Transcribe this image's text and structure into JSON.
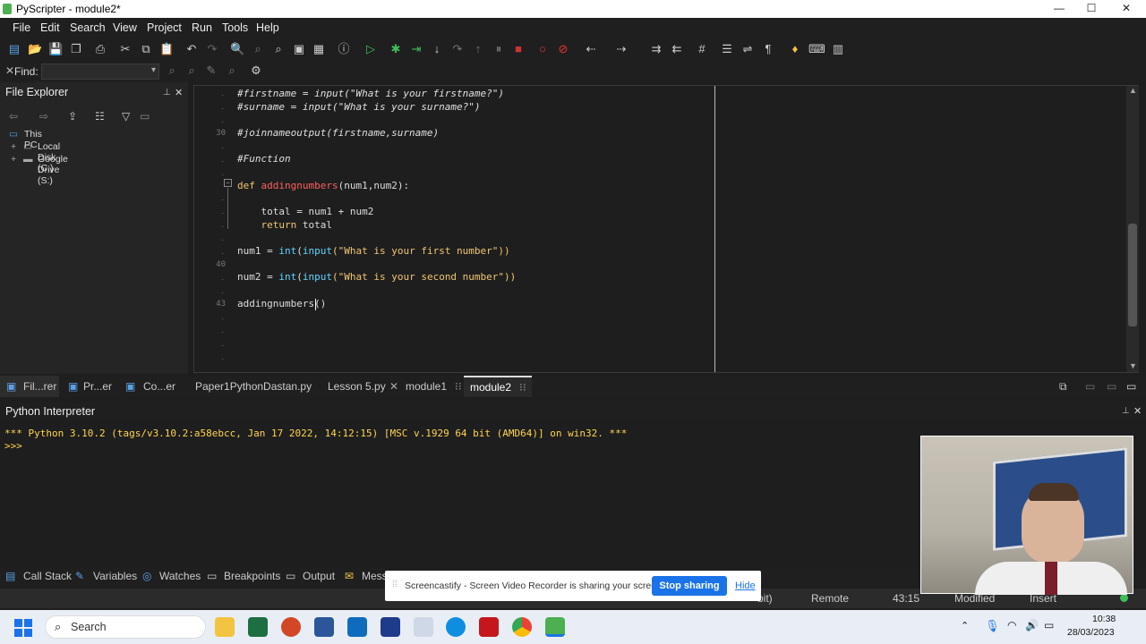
{
  "window": {
    "title": "PyScripter - module2*"
  },
  "menu": [
    "File",
    "Edit",
    "Search",
    "View",
    "Project",
    "Run",
    "Tools",
    "Help"
  ],
  "find": {
    "label": "Find:",
    "value": ""
  },
  "file_explorer": {
    "title": "File Explorer",
    "tree": [
      {
        "label": "This PC"
      },
      {
        "label": "Local Disk (C:)"
      },
      {
        "label": "Google Drive (S:)"
      }
    ]
  },
  "editor": {
    "line_numbers": {
      "l30": "30",
      "l40": "40",
      "l43": "43"
    },
    "lines": {
      "a": "#firstname = input(\"What is your firstname?\")",
      "b": "#surname = input(\"What is your surname?\")",
      "c": "#joinnameoutput(firstname,surname)",
      "d": "#Function",
      "e_kw": "def ",
      "e_fn": "addingnumbers",
      "e_rest": "(num1,num2):",
      "f": "    total = num1 + num2",
      "g_kw": "    return",
      "g_rest": " total",
      "h1": "num1 = ",
      "h2": "int",
      "h3": "(",
      "h4": "input",
      "h5": "(\"What is your first number\"))",
      "i1": "num2 = ",
      "i2": "int",
      "i3": "(",
      "i4": "input",
      "i5": "(\"What is your second number\"))",
      "j": "addingnumbers()"
    }
  },
  "panel_tabs": [
    "Fil...rer",
    "Pr...er",
    "Co...er"
  ],
  "editor_tabs": [
    "Paper1PythonDastan.py",
    "Lesson 5.py",
    "module1",
    "module2"
  ],
  "interpreter": {
    "title": "Python Interpreter",
    "banner": "*** Python 3.10.2 (tags/v3.10.2:a58ebcc, Jan 17 2022, 14:12:15) [MSC v.1929 64 bit (AMD64)] on win32. ***",
    "prompt": ">>>"
  },
  "dock_tabs": [
    "Call Stack",
    "Variables",
    "Watches",
    "Breakpoints",
    "Output",
    "Mess"
  ],
  "status": {
    "bits": "-bit)",
    "remote": "Remote",
    "position": "43:15",
    "modified": "Modified",
    "insert": "Insert"
  },
  "notification": {
    "text": "Screencastify - Screen Video Recorder is sharing your screen.",
    "stop": "Stop sharing",
    "hide": "Hide"
  },
  "taskbar": {
    "search": "Search",
    "time": "10:38",
    "date": "28/03/2023"
  }
}
